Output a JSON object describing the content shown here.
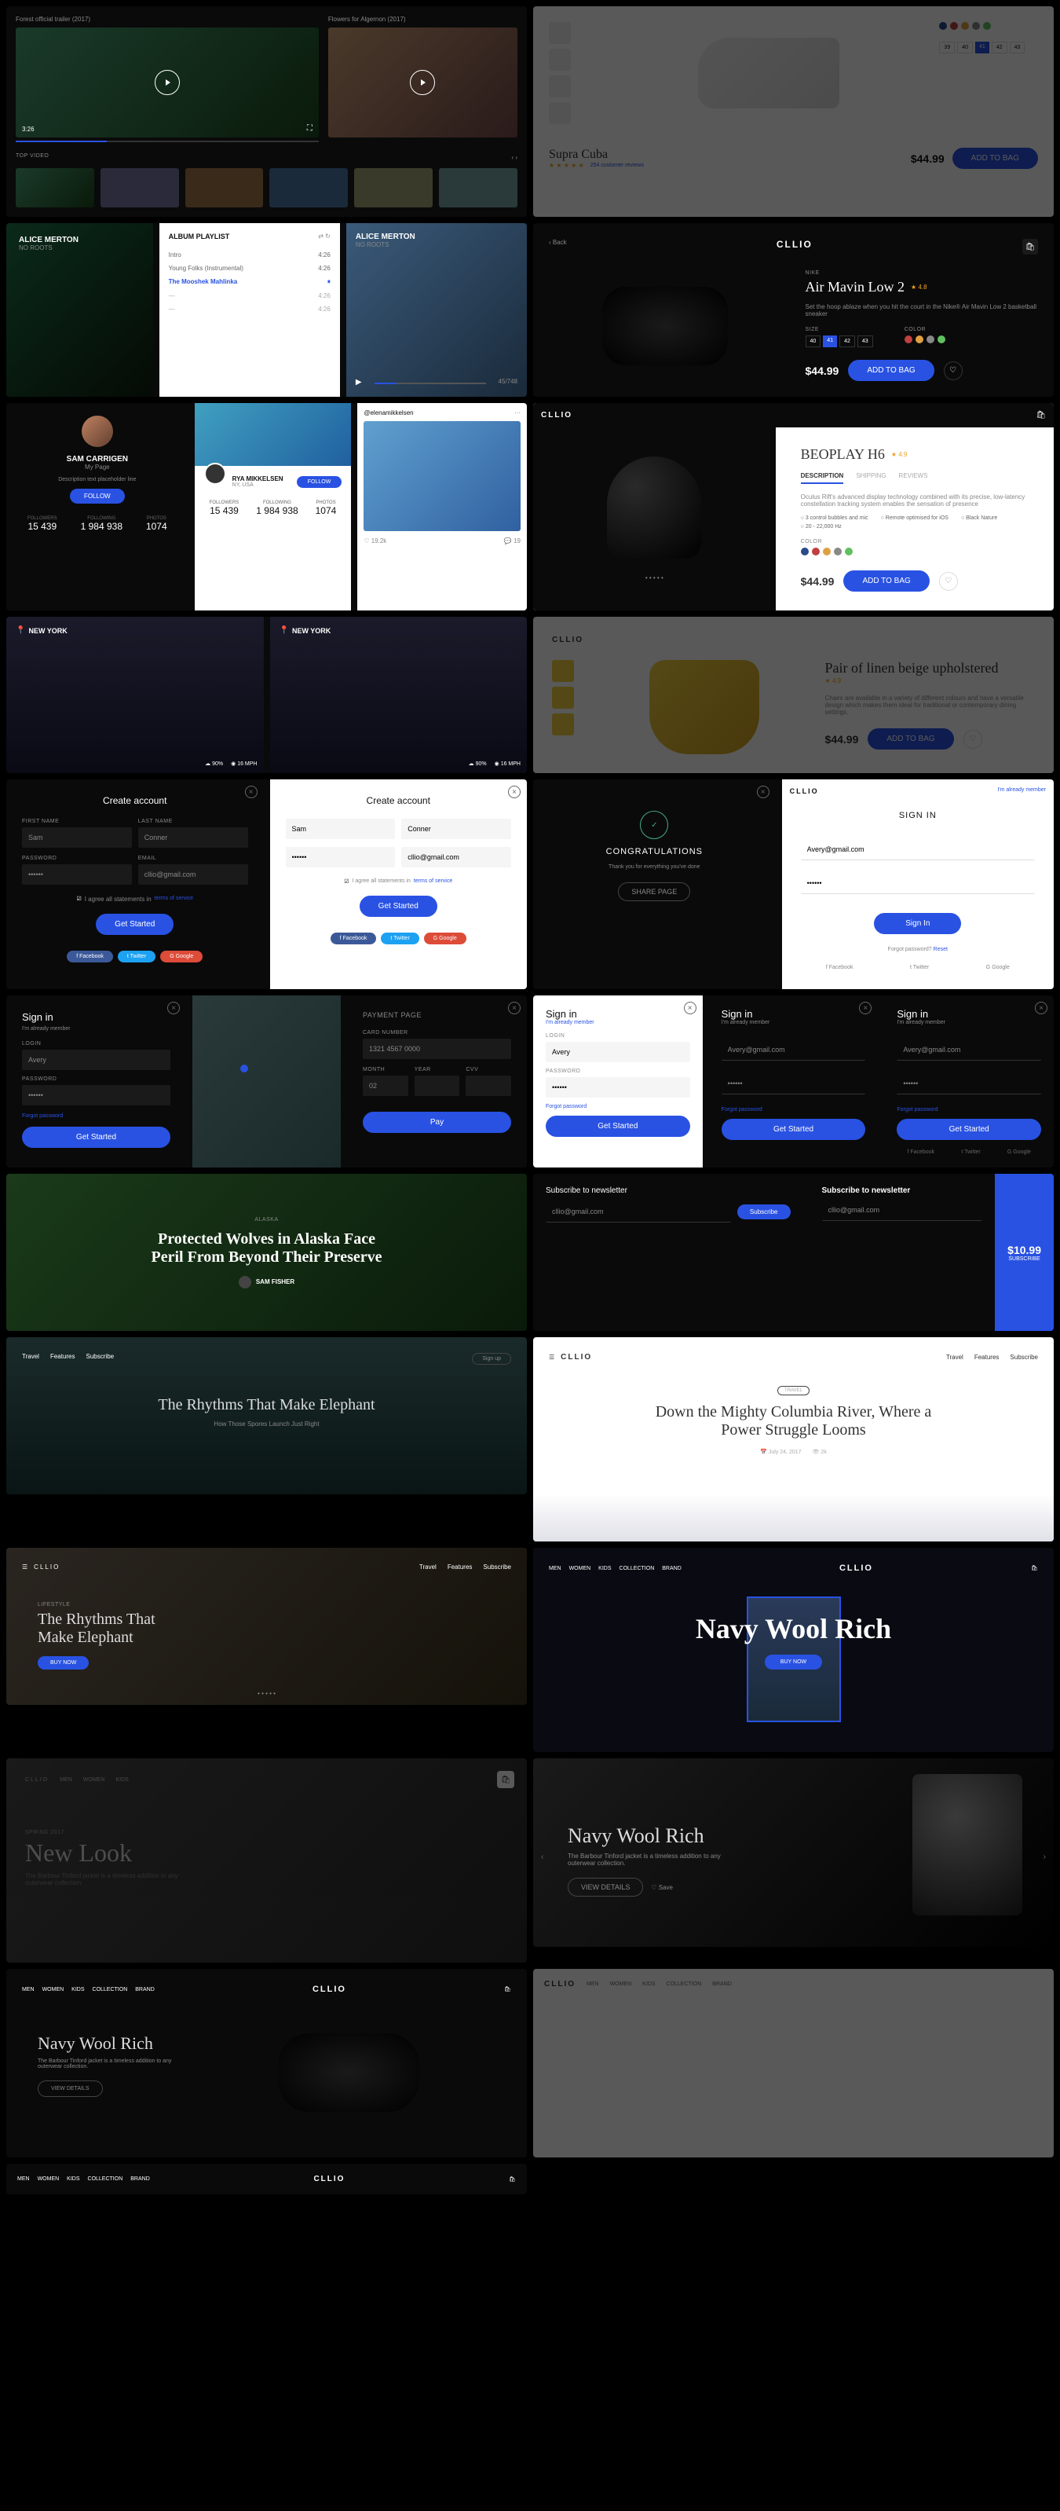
{
  "videos": {
    "featured1": {
      "title": "Forest official trailer (2017)",
      "duration": "3:26"
    },
    "featured2": {
      "title": "Flowers for Algernon (2017)",
      "duration": ""
    },
    "top_label": "TOP VIDEO"
  },
  "music": {
    "artist": "ALICE MERTON",
    "track": "NO ROOTS",
    "playlist_title": "ALBUM PLAYLIST",
    "songs": [
      {
        "title": "Intro",
        "dur": "4:26"
      },
      {
        "title": "Young Folks (Instrumental)",
        "dur": "4:26"
      },
      {
        "title": "The Mooshek Mahlinka",
        "dur": "4:26"
      },
      {
        "title": "—",
        "dur": "4:26"
      },
      {
        "title": "—",
        "dur": "4:26"
      }
    ],
    "progress": "45/748"
  },
  "profile1": {
    "name": "SAM CARRIGEN",
    "tagline": "My Page",
    "bio": "Description text placeholder line",
    "btn": "FOLLOW",
    "stats": [
      {
        "label": "FOLLOWERS",
        "value": "15 439"
      },
      {
        "label": "FOLLOWING",
        "value": "1 984 938"
      },
      {
        "label": "PHOTOS",
        "value": "1074"
      }
    ]
  },
  "profile2": {
    "name": "RYA MIKKELSEN",
    "location": "NY, USA",
    "btn": "FOLLOW",
    "stats": [
      {
        "label": "FOLLOWERS",
        "value": "15 439"
      },
      {
        "label": "FOLLOWING",
        "value": "1 984 938"
      },
      {
        "label": "PHOTOS",
        "value": "1074"
      }
    ]
  },
  "profile3": {
    "handle": "@elenamikkelsen"
  },
  "city": {
    "name": "NEW YORK",
    "metrics": [
      {
        "icon": "☁",
        "value": "90%"
      },
      {
        "icon": "◉",
        "value": "16 MPH"
      }
    ]
  },
  "createAccount": {
    "title": "Create account",
    "firstName": "FIRST NAME",
    "lastName": "LAST NAME",
    "password": "PASSWORD",
    "email": "EMAIL",
    "firstNameVal": "Sam",
    "lastNameVal": "Conner",
    "emailVal": "cllio@gmail.com",
    "agree": "I agree all statements in",
    "terms": "terms of service",
    "btn": "Get Started",
    "fb": "Facebook",
    "tw": "Twitter",
    "gg": "Google"
  },
  "signin": {
    "title": "Sign in",
    "already": "I'm already member",
    "login": "LOGIN",
    "password": "PASSWORD",
    "loginVal": "Avery",
    "emailVal": "Avery@gmail.com",
    "forgot": "Forgot password",
    "btn": "Get Started",
    "signInBtn": "Sign In",
    "signInCaps": "SIGN IN",
    "forgotQ": "Forgot password?",
    "reset": "Reset"
  },
  "payment": {
    "title": "PAYMENT PAGE",
    "cardLabel": "CARD NUMBER",
    "cardVal": "1321 4567 0000",
    "month": "MONTH",
    "year": "YEAR",
    "cvv": "CVV",
    "monthVal": "02",
    "btn": "Pay"
  },
  "article1": {
    "kicker": "ALASKA",
    "title": "Protected Wolves in Alaska Face Peril From Beyond Their Preserve",
    "author": "SAM FISHER"
  },
  "article2": {
    "title": "The Rhythms That Make Elephant",
    "subtitle": "How Those Spores Launch Just Right",
    "nav": [
      "Travel",
      "Features",
      "Subscribe"
    ],
    "signup": "Sign up"
  },
  "article3": {
    "kicker": "LIFESTYLE",
    "title": "The Rhythms That Make Elephant",
    "btn": "BUY NOW"
  },
  "article4": {
    "kicker": "TRAVEL",
    "title": "Down the Mighty Columbia River, Where a Power Struggle Looms",
    "date": "July 24, 2017",
    "views": "2k"
  },
  "product1": {
    "name": "Supra Cuba",
    "reviews": "254 customer reviews",
    "price": "$44.99",
    "btn": "ADD TO BAG",
    "sizes": [
      "39",
      "40",
      "41",
      "42",
      "43"
    ],
    "selected_size": "41"
  },
  "product2": {
    "brand": "NIKE",
    "name": "Air Mavin Low 2",
    "rating": "4.8",
    "desc": "Set the hoop ablaze when you hit the court in the Nike® Air Mavin Low 2 basketball sneaker",
    "sizeLabel": "SIZE",
    "colorLabel": "COLOR",
    "sizes": [
      "40",
      "41",
      "42",
      "43"
    ],
    "price": "$44.99",
    "btn": "ADD TO BAG",
    "back": "Back"
  },
  "product3": {
    "name": "BEOPLAY H6",
    "rating": "4.9",
    "tabs": [
      "DESCRIPTION",
      "SHIPPING",
      "REVIEWS"
    ],
    "desc": "Oculus Rift's advanced display technology combined with its precise, low-latency constellation tracking system enables the sensation of presence",
    "features": [
      "3 control bubbles and mic",
      "Black Nature",
      "Remote optimised for iOS",
      "20 - 22,000 Hz"
    ],
    "colorLabel": "COLOR",
    "price": "$44.99",
    "btn": "ADD TO BAG"
  },
  "product4": {
    "name": "Pair of linen beige upholstered",
    "rating": "4.9",
    "desc": "Chairs are available in a variety of different colours and have a versatile design which makes them ideal for traditional or contemporary dining settings.",
    "price": "$44.99",
    "btn": "ADD TO BAG"
  },
  "congrats": {
    "title": "CONGRATULATIONS",
    "subtitle": "Thank you for everything you've done",
    "btn": "SHARE PAGE"
  },
  "newsletter": {
    "title": "Subscribe to newsletter",
    "email": "cllio@gmail.com",
    "btn": "Subscribe",
    "price": "$10.99",
    "priceBtn": "SUBSCRIBE"
  },
  "hero1": {
    "brand": "CLLIO",
    "nav": [
      "MEN",
      "WOMEN",
      "KIDS",
      "COLLECTION",
      "BRAND"
    ],
    "title": "Navy Wool Rich",
    "btn": "BUY NOW"
  },
  "hero2": {
    "kicker": "SPRING 2017",
    "title": "New Look",
    "desc": "The Barbour Tinford jacket is a timeless addition to any outerwear collection."
  },
  "hero3": {
    "title": "Navy Wool Rich",
    "desc": "The Barbour Tinford jacket is a timeless addition to any outerwear collection.",
    "btn": "VIEW DETAILS",
    "save": "Save"
  },
  "hero4": {
    "title": "Navy Wool Rich",
    "desc": "The Barbour Tinford jacket is a timeless addition to any outerwear collection.",
    "btn": "VIEW DETAILS"
  },
  "brand": "CLLIO",
  "footer_nav": [
    "MEN",
    "WOMEN",
    "KIDS",
    "COLLECTION",
    "BRAND"
  ],
  "signin_nav": [
    "MEN",
    "WOMEN",
    "KIDS",
    "COLLECTION",
    "BRAND"
  ]
}
